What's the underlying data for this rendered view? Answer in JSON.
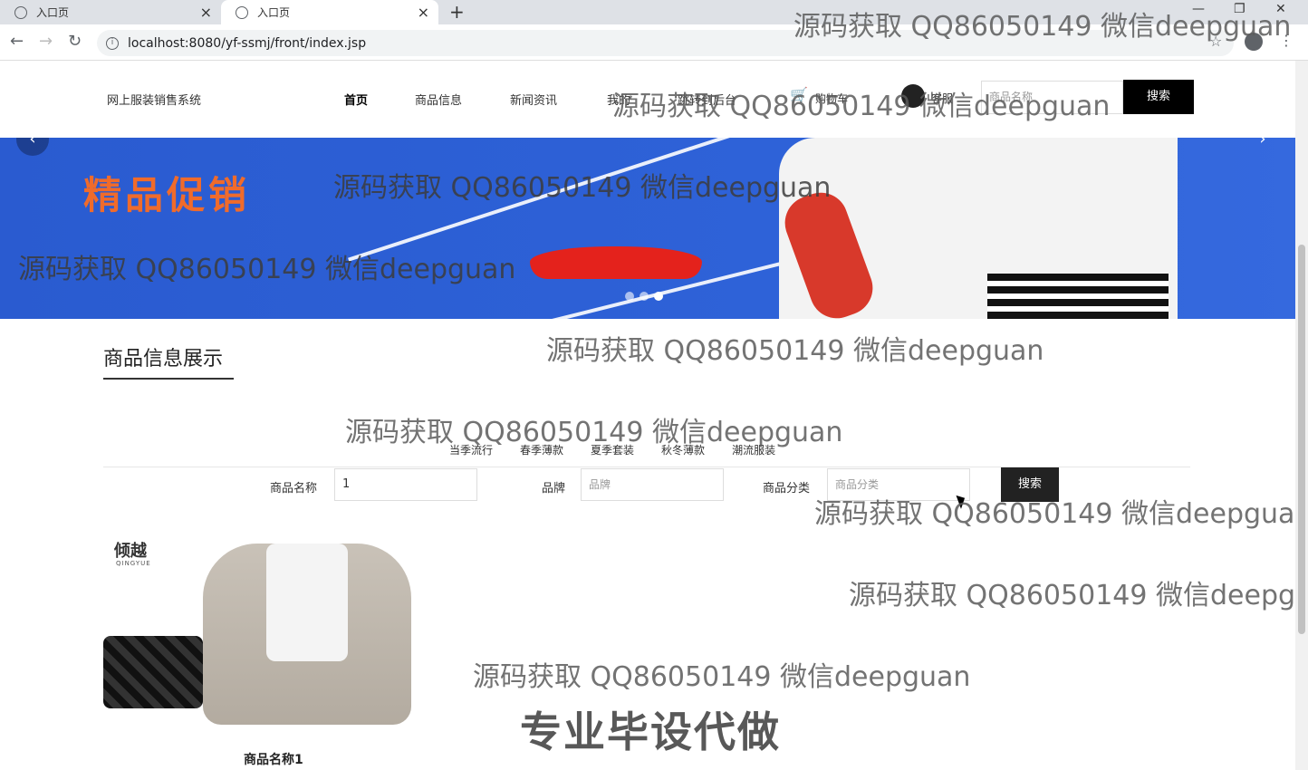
{
  "browser": {
    "tabs": [
      {
        "title": "入口页",
        "active": false
      },
      {
        "title": "入口页",
        "active": true
      }
    ],
    "url": "localhost:8080/yf-ssmj/front/index.jsp"
  },
  "header": {
    "brand": "网上服装销售系统",
    "nav": [
      "首页",
      "商品信息",
      "新闻资讯",
      "我的",
      "跳转到后台",
      "购物车",
      "客服"
    ],
    "search_placeholder": "商品名称",
    "search_button": "搜索"
  },
  "banner": {
    "promo_text": "精品促销",
    "slide_count": 3,
    "active_slide": 3
  },
  "section": {
    "title": "商品信息展示",
    "categories": [
      "当季流行",
      "春季薄款",
      "夏季套装",
      "秋冬薄款",
      "潮流服装"
    ]
  },
  "filters": {
    "name_label": "商品名称",
    "name_value": "1",
    "brand_label": "品牌",
    "brand_placeholder": "品牌",
    "category_label": "商品分类",
    "category_placeholder": "商品分类",
    "search_button": "搜索"
  },
  "products": [
    {
      "name": "商品名称1",
      "logo": "倾越",
      "logo_sub": "QINGYUE"
    }
  ],
  "watermarks": {
    "qq": "源码获取 QQ86050149 微信deepguan",
    "qq_cut": "源码获取 QQ86050149 微信deepgu",
    "big": "专业毕设代做"
  }
}
